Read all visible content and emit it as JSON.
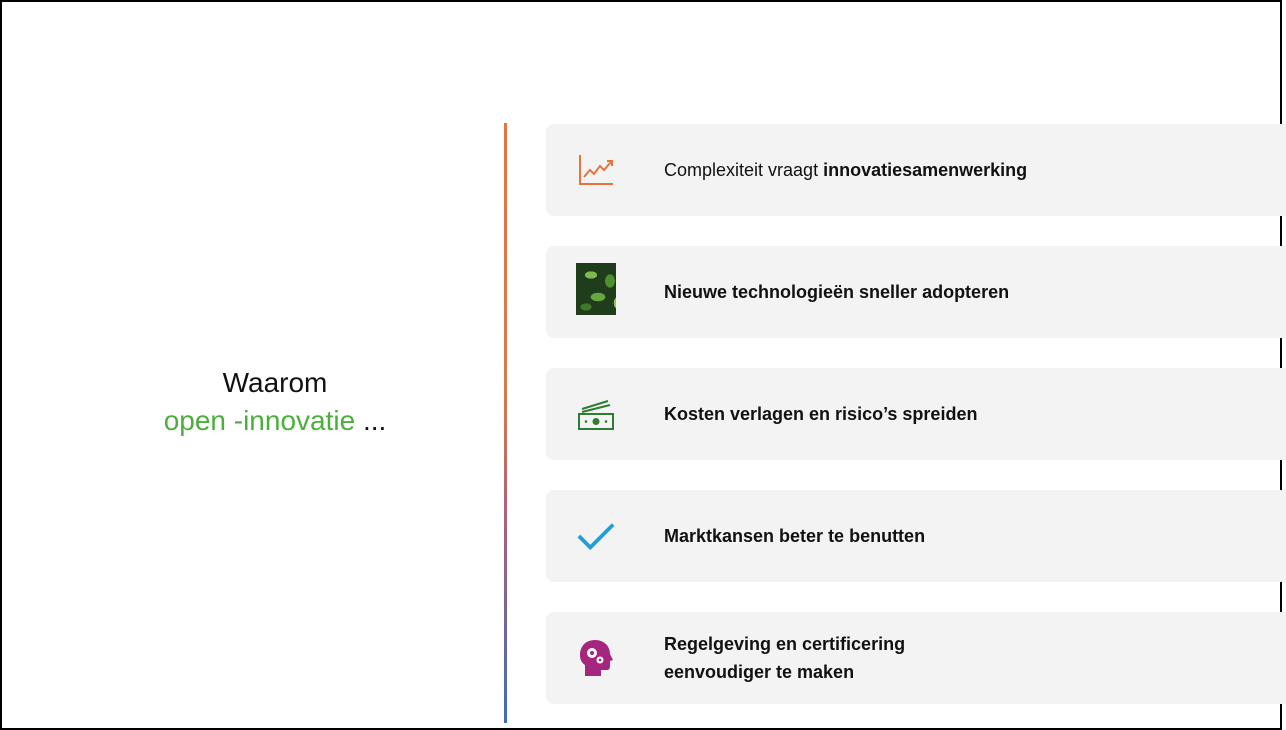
{
  "heading": {
    "line1": "Waarom",
    "accent": "open -innovatie",
    "ellipsis": "..."
  },
  "colors": {
    "accent_green": "#4caf3d",
    "chart_icon": "#e8743b",
    "check_icon": "#1f9fd8",
    "head_icon": "#a4267f",
    "money_icon": "#2e7d32"
  },
  "items": [
    {
      "icon": "trend-chart-icon",
      "text_prefix": "Complexiteit vraagt ",
      "text_bold": "innovatiesamenwerking"
    },
    {
      "icon": "leaves-image-icon",
      "text_bold": "Nieuwe technologieën sneller adopteren"
    },
    {
      "icon": "money-icon",
      "text_bold": "Kosten verlagen en risico’s spreiden"
    },
    {
      "icon": "checkmark-icon",
      "text_bold": "Marktkansen beter te benutten"
    },
    {
      "icon": "head-gears-icon",
      "text_bold_line1": "Regelgeving en certificering",
      "text_bold_line2": "eenvoudiger te maken"
    }
  ]
}
